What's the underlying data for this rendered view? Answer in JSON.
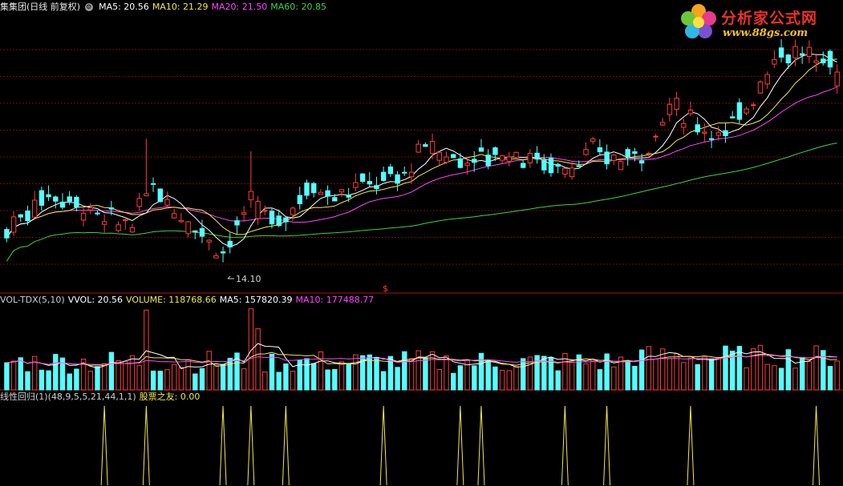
{
  "header": {
    "stock_name": "集集团(日线 前复权)",
    "ma_labels": [
      {
        "text": "MA5: 20.56",
        "color": "#ffffff"
      },
      {
        "text": "MA10: 21.29",
        "color": "#f2e94a"
      },
      {
        "text": "MA20: 21.50",
        "color": "#ff44ff"
      },
      {
        "text": "MA60: 20.85",
        "color": "#3fd23f"
      }
    ]
  },
  "logo": {
    "brand": "分析家公式网",
    "url": "www.88gs.com"
  },
  "price_panel": {
    "low_marker": "14.10",
    "dollar_marker": "$"
  },
  "volume_panel": {
    "labels": [
      {
        "text": "VOL-TDX(5,10)",
        "color": "#cfcfcf"
      },
      {
        "text": "VVOL: 20.56",
        "color": "#ffffff"
      },
      {
        "text": "VOLUME: 118768.66",
        "color": "#f2e94a"
      },
      {
        "text": "MA5: 157820.39",
        "color": "#ffffff"
      },
      {
        "text": "MA10: 177488.77",
        "color": "#ff44ff"
      }
    ]
  },
  "indicator_panel": {
    "labels": [
      {
        "text": "线性回归(1)(48,9,5,5,21,44,1,1)",
        "color": "#cfcfcf"
      },
      {
        "text": "股票之友: 0.00",
        "color": "#f2e94a"
      }
    ]
  },
  "colors": {
    "up": "#ff3c3c",
    "down": "#54ffff",
    "grid": "#7a0a0a",
    "separator": "#b01010"
  },
  "chart_data": {
    "type": "candlestick",
    "price_ylim": [
      12.8,
      25.8
    ],
    "volume_ylim": [
      0,
      310000
    ],
    "series_names": [
      "MA5",
      "MA10",
      "MA20",
      "MA60"
    ],
    "spike_positions": [
      14,
      20,
      31,
      35,
      40,
      54,
      65,
      68,
      80,
      86,
      98,
      116
    ],
    "bars": 120
  }
}
